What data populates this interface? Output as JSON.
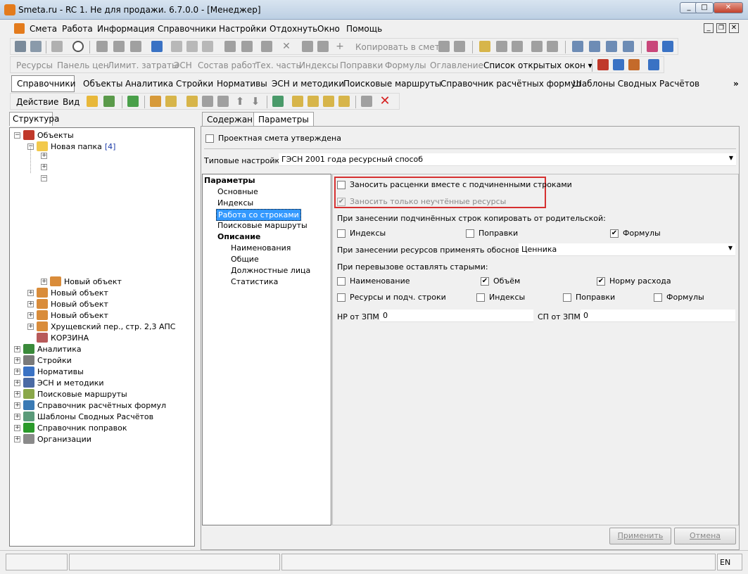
{
  "window": {
    "title": "Smeta.ru - RC 1. Не для продажи.  6.7.0.0   - [Менеджер]",
    "buttons": {
      "minimize": "_",
      "maximize": "□",
      "close": "✕"
    }
  },
  "menu": [
    "Смета",
    "Работа",
    "Информация",
    "Справочники",
    "Настройки",
    "Отдохнуть",
    "Окно",
    "Помощь"
  ],
  "toolbar1": {
    "copy_label": "Копировать в смету"
  },
  "toolbar2": {
    "items": [
      "Ресурсы",
      "Панель цен",
      "Лимит. затраты",
      "ЭСН",
      "Состав работ",
      "Тех. часть",
      "Индексы",
      "Поправки",
      "Формулы",
      "Оглавление"
    ],
    "open_windows": "Список открытых окон ▾"
  },
  "tabs": [
    "Справочники",
    "Объекты",
    "Аналитика",
    "Стройки",
    "Нормативы",
    "ЭСН и методики",
    "Поисковые маршруты",
    "Справочник расчётных формул",
    "Шаблоны Сводных Расчётов"
  ],
  "more": "»",
  "actions": {
    "action": "Действие",
    "view": "Вид"
  },
  "left": {
    "tab": "Структура",
    "tree": [
      {
        "label": "Объекты",
        "level": 0,
        "exp": "−",
        "icon": "objects-icon"
      },
      {
        "label": "Новая папка",
        "count": "[4]",
        "level": 1,
        "exp": "−",
        "icon": "folder-icon"
      },
      {
        "label": "",
        "level": 2,
        "exp": "+",
        "icon": ""
      },
      {
        "label": "",
        "level": 2,
        "exp": "+",
        "icon": ""
      },
      {
        "label": "",
        "level": 2,
        "exp": "−",
        "icon": ""
      },
      {
        "label": "Новый объект",
        "level": 2,
        "exp": "+",
        "icon": "house-icon"
      },
      {
        "label": "Новый объект",
        "level": 1,
        "exp": "+",
        "icon": "house-icon"
      },
      {
        "label": "Новый объект",
        "level": 1,
        "exp": "+",
        "icon": "house-icon"
      },
      {
        "label": "Новый объект",
        "level": 1,
        "exp": "+",
        "icon": "house-icon"
      },
      {
        "label": "Хрущевский пер., стр. 2,3 АПС",
        "level": 1,
        "exp": "+",
        "icon": "house-icon"
      },
      {
        "label": "КОРЗИНА",
        "level": 1,
        "exp": "",
        "icon": "trash-icon"
      },
      {
        "label": "Аналитика",
        "level": 0,
        "exp": "+",
        "icon": "chart-icon"
      },
      {
        "label": "Стройки",
        "level": 0,
        "exp": "+",
        "icon": "building-icon"
      },
      {
        "label": "Нормативы",
        "level": 0,
        "exp": "+",
        "icon": "book-icon"
      },
      {
        "label": "ЭСН и методики",
        "level": 0,
        "exp": "+",
        "icon": "books-icon"
      },
      {
        "label": "Поисковые маршруты",
        "level": 0,
        "exp": "+",
        "icon": "route-icon"
      },
      {
        "label": "Справочник расчётных формул",
        "level": 0,
        "exp": "+",
        "icon": "formula-icon"
      },
      {
        "label": "Шаблоны Сводных Расчётов",
        "level": 0,
        "exp": "+",
        "icon": "template-icon"
      },
      {
        "label": "Справочник поправок",
        "level": 0,
        "exp": "+",
        "icon": "plusminus-icon"
      },
      {
        "label": "Организации",
        "level": 0,
        "exp": "+",
        "icon": "org-icon"
      }
    ]
  },
  "right": {
    "tabs": [
      "Содержание",
      "Параметры"
    ],
    "approved_label": "Проектная смета утверждена",
    "typical_label": "Типовые настройки:",
    "typical_value": "ГЭСН 2001 года ресурсный способ",
    "params_tree": {
      "header": "Параметры",
      "items": [
        "Основные",
        "Индексы",
        "Работа со строками",
        "Поисковые маршруты"
      ],
      "sub_header": "Описание",
      "sub_items": [
        "Наименования",
        "Общие",
        "Должностные лица",
        "Статистика"
      ]
    },
    "settings": {
      "cb_with_sub": "Заносить расценки вместе с подчиненными строками",
      "cb_only_unaccounted": "Заносить только неучтённые ресурсы",
      "copy_from_parent": "При занесении подчинённых строк копировать от родительской:",
      "copy_opts": [
        {
          "label": "Индексы",
          "checked": false
        },
        {
          "label": "Поправки",
          "checked": false
        },
        {
          "label": "Формулы",
          "checked": true
        }
      ],
      "apply_reason_label": "При занесении ресурсов применять обоснование:",
      "apply_reason_value": "Ценника",
      "keep_old": "При перевызове оставлять старыми:",
      "keep_row1": [
        {
          "label": "Наименование",
          "checked": false
        },
        {
          "label": "Объём",
          "checked": true
        },
        {
          "label": "Норму расхода",
          "checked": true
        }
      ],
      "keep_row2": [
        {
          "label": "Ресурсы и подч. строки",
          "checked": false
        },
        {
          "label": "Индексы",
          "checked": false
        },
        {
          "label": "Поправки",
          "checked": false
        },
        {
          "label": "Формулы",
          "checked": false
        }
      ],
      "np_label": "НР от ЗПМ:",
      "np_value": "0",
      "sp_label": "СП от ЗПМ:",
      "sp_value": "0"
    },
    "buttons": {
      "apply": "Применить",
      "cancel": "Отмена"
    }
  },
  "status": {
    "lang": "EN"
  }
}
